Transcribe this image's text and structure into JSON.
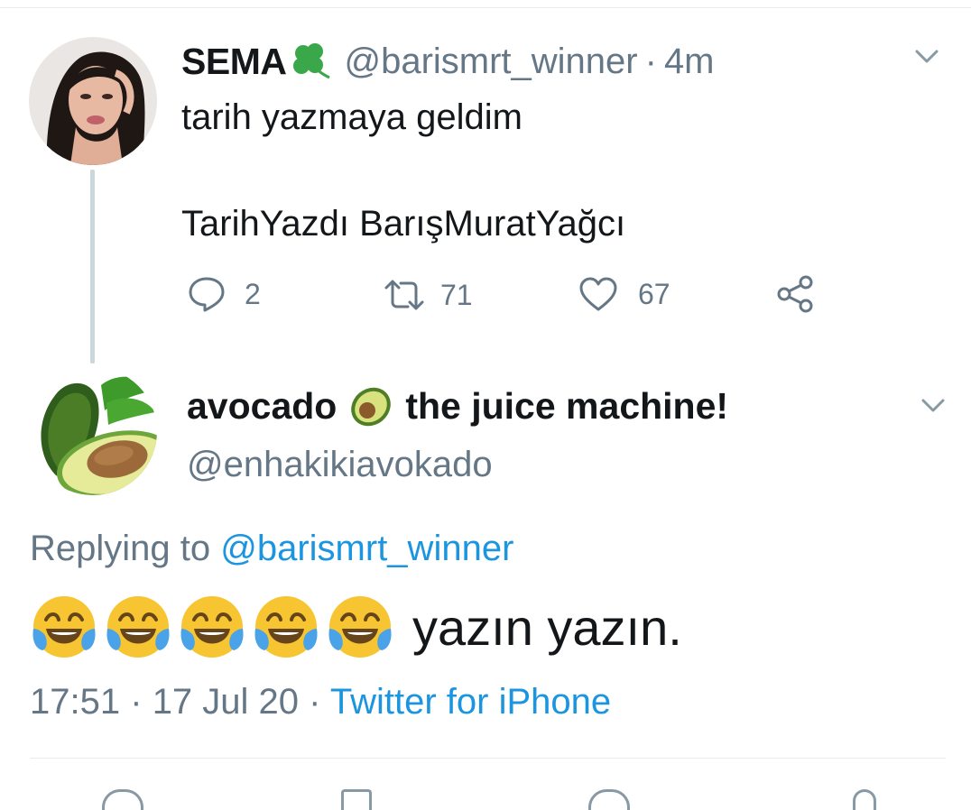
{
  "tweet1": {
    "name": "SEMA",
    "name_emoji_icon": "four-leaf-clover-icon",
    "handle": "@barismrt_winner",
    "separator": "·",
    "time": "4m",
    "text_line1": "tarih yazmaya geldim",
    "text_line2": "TarihYazdı BarışMuratYağcı",
    "replies": "2",
    "retweets": "71",
    "likes": "67"
  },
  "tweet2": {
    "name_part1": "avocado",
    "name_emoji_icon": "avocado-icon",
    "name_part2": "the juice machine!",
    "handle": "@enhakikiavokado",
    "replying_prefix": "Replying to",
    "replying_handle": "@barismrt_winner",
    "emoji_icon": "face-with-tears-of-joy-icon",
    "emoji_count": 5,
    "text": "yazın yazın.",
    "time": "17:51",
    "separator": "·",
    "date": "17 Jul 20",
    "source": "Twitter for iPhone"
  },
  "colors": {
    "text": "#14171a",
    "secondary": "#657786",
    "link": "#1b95e0",
    "divider": "#e6ecf0",
    "thread": "#ccd6dd"
  }
}
